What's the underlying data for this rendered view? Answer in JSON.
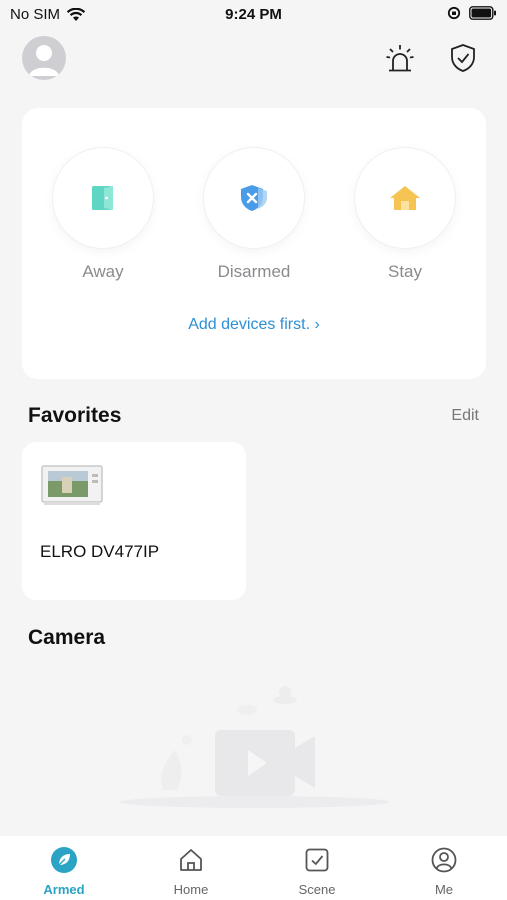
{
  "status_bar": {
    "carrier": "No SIM",
    "time": "9:24 PM"
  },
  "header": {
    "avatar": "person-icon",
    "alarm_icon": "siren-icon",
    "security_icon": "shield-check-icon"
  },
  "modes": [
    {
      "label": "Away",
      "icon": "door-icon",
      "color": "#5fd6c4"
    },
    {
      "label": "Disarmed",
      "icon": "shield-x-icon",
      "color": "#4a9be8"
    },
    {
      "label": "Stay",
      "icon": "house-icon",
      "color": "#f5c453"
    }
  ],
  "add_devices": "Add devices first. ›",
  "favorites": {
    "title": "Favorites",
    "edit_label": "Edit",
    "items": [
      {
        "name": "ELRO DV477IP"
      }
    ]
  },
  "camera": {
    "title": "Camera"
  },
  "tabs": [
    {
      "label": "Armed",
      "icon": "leaf-icon",
      "active": true,
      "color": "#2aa3c4"
    },
    {
      "label": "Home",
      "icon": "home-icon",
      "active": false
    },
    {
      "label": "Scene",
      "icon": "checkbox-icon",
      "active": false
    },
    {
      "label": "Me",
      "icon": "user-circle-icon",
      "active": false
    }
  ]
}
